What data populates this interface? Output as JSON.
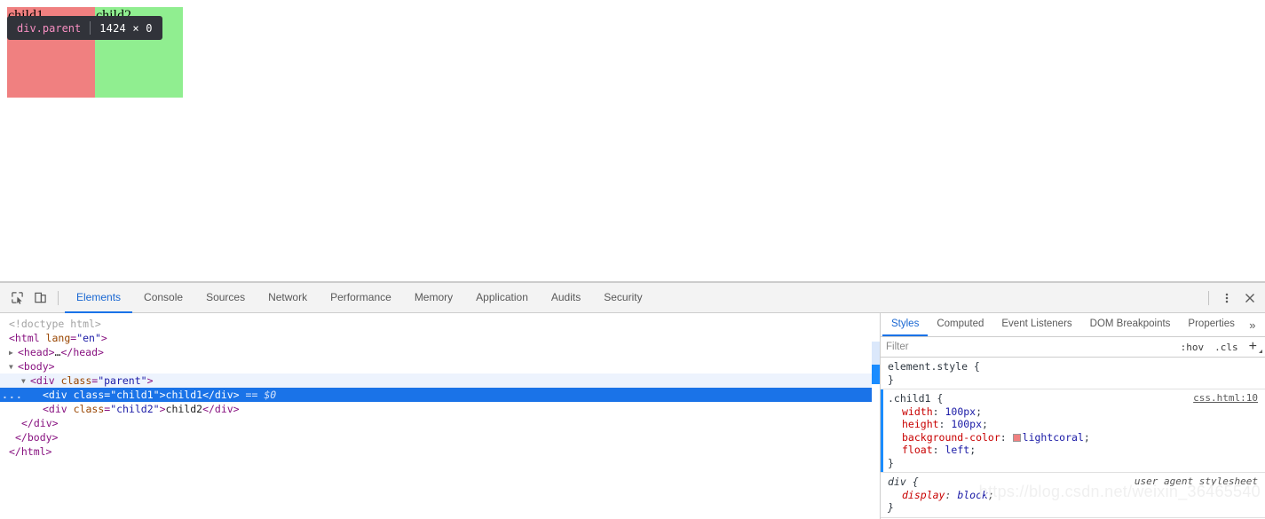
{
  "viewport": {
    "parent_class": "parent",
    "children": [
      {
        "label": "child1",
        "class": "child1",
        "color": "#F08080"
      },
      {
        "label": "child2",
        "class": "child2",
        "color": "#90EE90"
      }
    ],
    "inspector_tooltip": {
      "selector": "div.parent",
      "dimensions": "1424 × 0"
    }
  },
  "devtools": {
    "toolbar": {
      "inspect_icon": "inspect-element-icon",
      "device_icon": "device-toolbar-icon",
      "more_icon": "more-vertical-icon",
      "close_icon": "close-icon",
      "tabs": [
        {
          "label": "Elements",
          "active": true
        },
        {
          "label": "Console",
          "active": false
        },
        {
          "label": "Sources",
          "active": false
        },
        {
          "label": "Network",
          "active": false
        },
        {
          "label": "Performance",
          "active": false
        },
        {
          "label": "Memory",
          "active": false
        },
        {
          "label": "Application",
          "active": false
        },
        {
          "label": "Audits",
          "active": false
        },
        {
          "label": "Security",
          "active": false
        }
      ]
    },
    "dom_tree": {
      "gutter_marker": "...",
      "rows": [
        {
          "indent": 0,
          "kind": "doctype",
          "text": "<!doctype html>"
        },
        {
          "indent": 0,
          "kind": "open",
          "text": "<html lang=\"en\">"
        },
        {
          "indent": 1,
          "kind": "collapsed",
          "text": "<head>…</head>"
        },
        {
          "indent": 1,
          "kind": "open",
          "text": "<body>"
        },
        {
          "indent": 2,
          "kind": "open",
          "text": "<div class=\"parent\">",
          "hover": true
        },
        {
          "indent": 3,
          "kind": "leaf",
          "text": "<div class=\"child1\">child1</div>",
          "suffix": "== $0",
          "selected": true
        },
        {
          "indent": 3,
          "kind": "leaf",
          "text": "<div class=\"child2\">child2</div>"
        },
        {
          "indent": 2,
          "kind": "close",
          "text": "</div>"
        },
        {
          "indent": 1,
          "kind": "close",
          "text": "</body>"
        },
        {
          "indent": 0,
          "kind": "close",
          "text": "</html>"
        }
      ]
    },
    "styles": {
      "tabs": [
        {
          "label": "Styles",
          "active": true
        },
        {
          "label": "Computed",
          "active": false
        },
        {
          "label": "Event Listeners",
          "active": false
        },
        {
          "label": "DOM Breakpoints",
          "active": false
        },
        {
          "label": "Properties",
          "active": false
        }
      ],
      "more_tabs_icon": "chevron-right-double-icon",
      "filter": {
        "placeholder": "Filter",
        "value": "",
        "hov_label": ":hov",
        "cls_label": ".cls",
        "new_rule_label": "+"
      },
      "rules": [
        {
          "selector": "element.style {",
          "close": "}",
          "source": "",
          "declarations": []
        },
        {
          "selector": ".child1 {",
          "close": "}",
          "source": "css.html:10",
          "marked": true,
          "declarations": [
            {
              "prop": "width",
              "value": "100px"
            },
            {
              "prop": "height",
              "value": "100px"
            },
            {
              "prop": "background-color",
              "value": "lightcoral",
              "swatch": "#F08080"
            },
            {
              "prop": "float",
              "value": "left"
            }
          ]
        },
        {
          "selector": "div {",
          "close": "}",
          "source_label": "user agent stylesheet",
          "user_agent": true,
          "declarations": [
            {
              "prop": "display",
              "value": "block"
            }
          ]
        }
      ]
    }
  },
  "watermark": "https://blog.csdn.net/weixin_36465540"
}
